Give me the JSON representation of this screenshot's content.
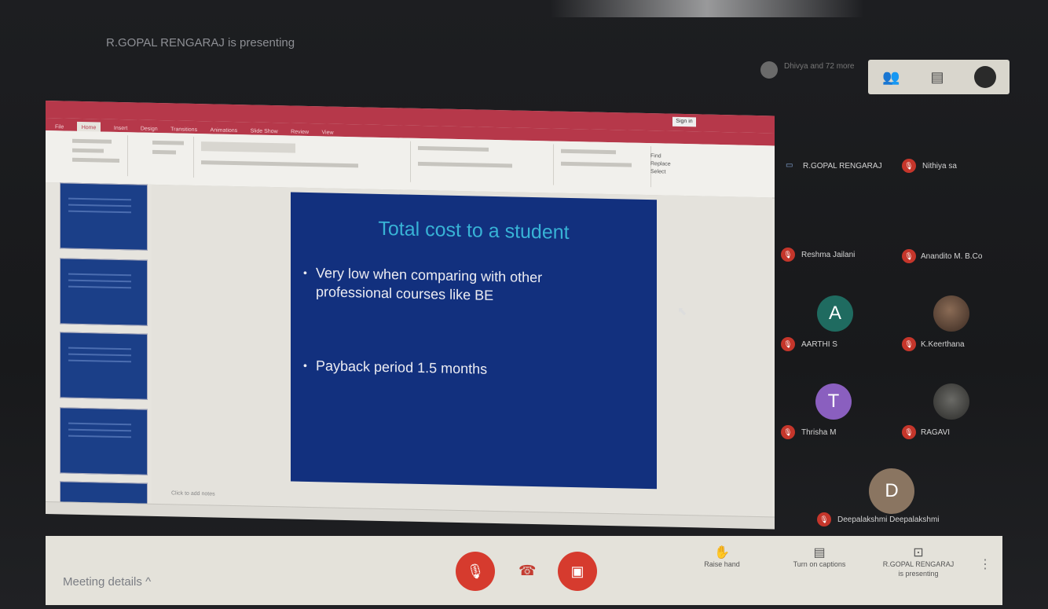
{
  "meeting": {
    "presenting_banner": "R.GOPAL RENGARAJ is presenting",
    "participant_summary": "Dhivya and 72 more"
  },
  "top_controls": {
    "people_icon": "people-icon",
    "chat_icon": "chat-icon"
  },
  "slide": {
    "title": "Total cost to a student",
    "bullets": [
      "Very low  when comparing with other professional courses  like BE",
      "Payback period 1.5 months"
    ]
  },
  "powerpoint": {
    "notes_placeholder": "Click to add notes"
  },
  "participants": [
    {
      "name": "R.GOPAL RENGARAJ",
      "initial": ""
    },
    {
      "name": "Nithiya sa",
      "initial": ""
    },
    {
      "name": "Reshma Jailani",
      "initial": ""
    },
    {
      "name": "Anandito M. B.Co",
      "initial": ""
    },
    {
      "name": "AARTHI S",
      "initial": "A"
    },
    {
      "name": "K.Keerthana",
      "initial": ""
    },
    {
      "name": "Thrisha M",
      "initial": "T"
    },
    {
      "name": "RAGAVI",
      "initial": ""
    },
    {
      "name": "Deepalakshmi Deepalakshmi",
      "initial": "D"
    }
  ],
  "colors": {
    "aarthi_avatar": "#1f6b60",
    "thrisha_avatar": "#8a5fbf",
    "deepa_avatar": "#8a7561",
    "mic_off_red": "#c5362b",
    "slide_bg": "#12307e",
    "slide_title": "#38b3d6"
  },
  "bottom_bar": {
    "meeting_details": "Meeting details",
    "raise_hand": "Raise hand",
    "captions": "Turn on captions",
    "presenting_line1": "R.GOPAL RENGARAJ",
    "presenting_line2": "is presenting"
  }
}
